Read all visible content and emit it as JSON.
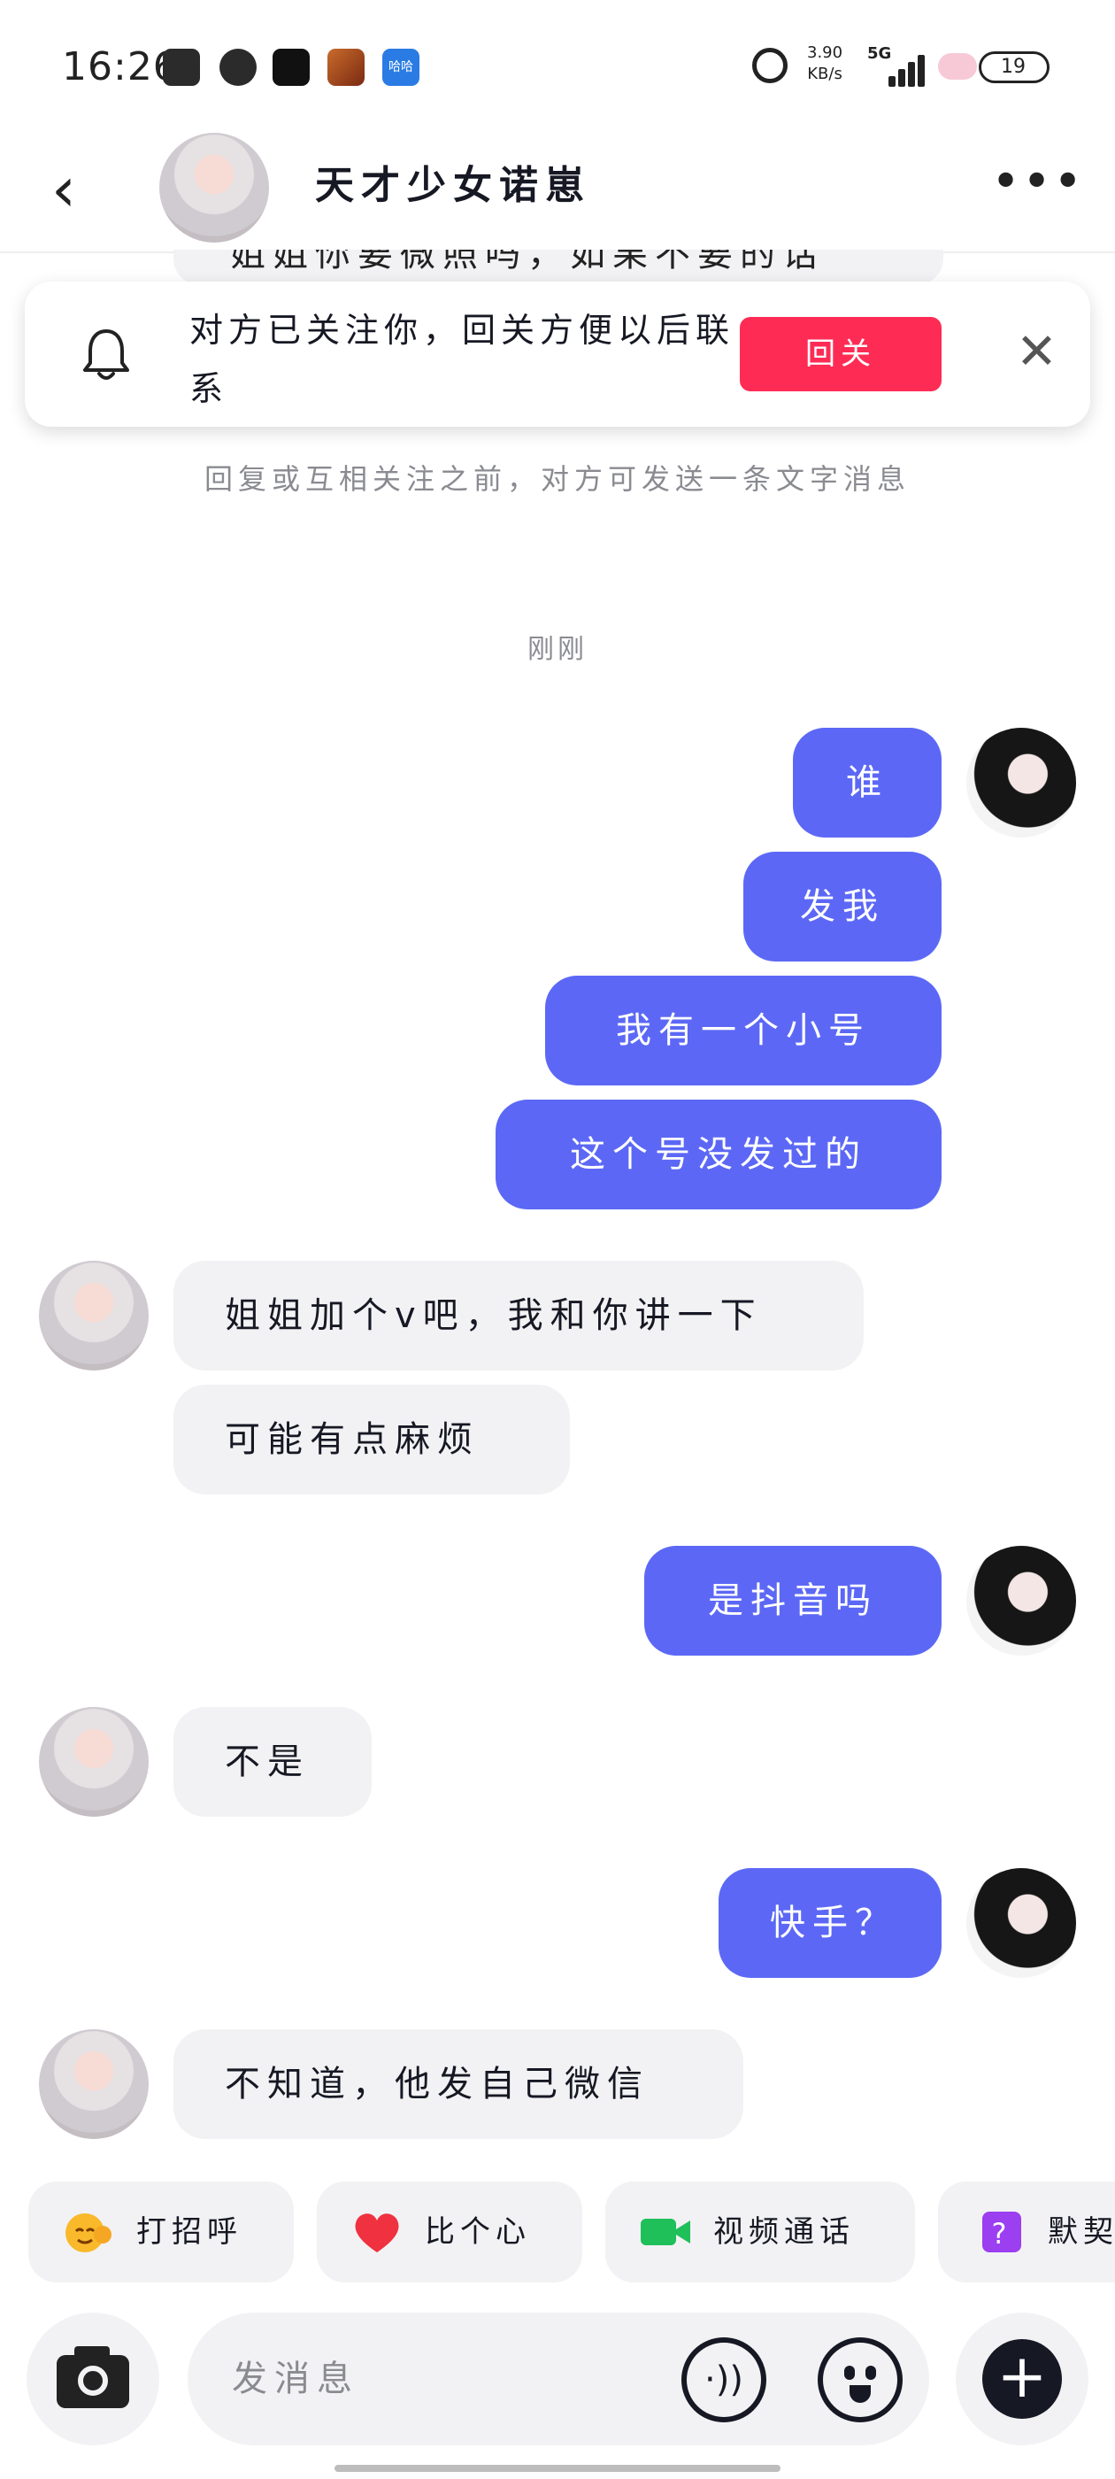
{
  "status_bar": {
    "time": "16:26",
    "app_icons": [
      "clock-app-icon",
      "wechat-icon",
      "tiktok-icon",
      "game-icon",
      "hahaha-app-icon"
    ],
    "small_app_label": "哈哈",
    "net_speed_value": "3.90",
    "net_speed_unit": "KB/s",
    "network": "5G",
    "battery": "19"
  },
  "header": {
    "back_icon": "chevron-left-icon",
    "title": "天才少女诺崽",
    "more_icon": "more-dots-icon"
  },
  "peek_bubble_text": "姐姐你要微照吗，如果不要的话",
  "notice": {
    "text": "对方已关注你，回关方便以后联系",
    "follow_button": "回关",
    "close_icon": "close-icon"
  },
  "system_note": "回复或互相关注之前，对方可发送一条文字消息",
  "timestamp": "刚刚",
  "messages": [
    {
      "side": "out",
      "text": "谁"
    },
    {
      "side": "out",
      "text": "发我"
    },
    {
      "side": "out",
      "text": "我有一个小号"
    },
    {
      "side": "out",
      "text": "这个号没发过的"
    },
    {
      "side": "in",
      "text": "姐姐加个v吧，我和你讲一下"
    },
    {
      "side": "in",
      "text": "可能有点麻烦"
    },
    {
      "side": "out",
      "text": "是抖音吗"
    },
    {
      "side": "in",
      "text": "不是"
    },
    {
      "side": "out",
      "text": "快手？"
    },
    {
      "side": "in",
      "text": "不知道，他发自己微信"
    }
  ],
  "quick_replies": [
    {
      "label": "打招呼",
      "icon": "wave-emoji-icon"
    },
    {
      "label": "比个心",
      "icon": "heart-icon"
    },
    {
      "label": "视频通话",
      "icon": "video-call-icon"
    },
    {
      "label": "默契",
      "icon": "question-card-icon"
    }
  ],
  "composer": {
    "placeholder": "发消息",
    "camera_icon": "camera-icon",
    "voice_icon": "voice-icon",
    "emoji_icon": "emoji-icon",
    "plus_icon": "plus-icon"
  },
  "colors": {
    "outgoing_bubble": "#5c68f5",
    "incoming_bubble": "#f2f2f4",
    "follow_button": "#fe2c55"
  }
}
